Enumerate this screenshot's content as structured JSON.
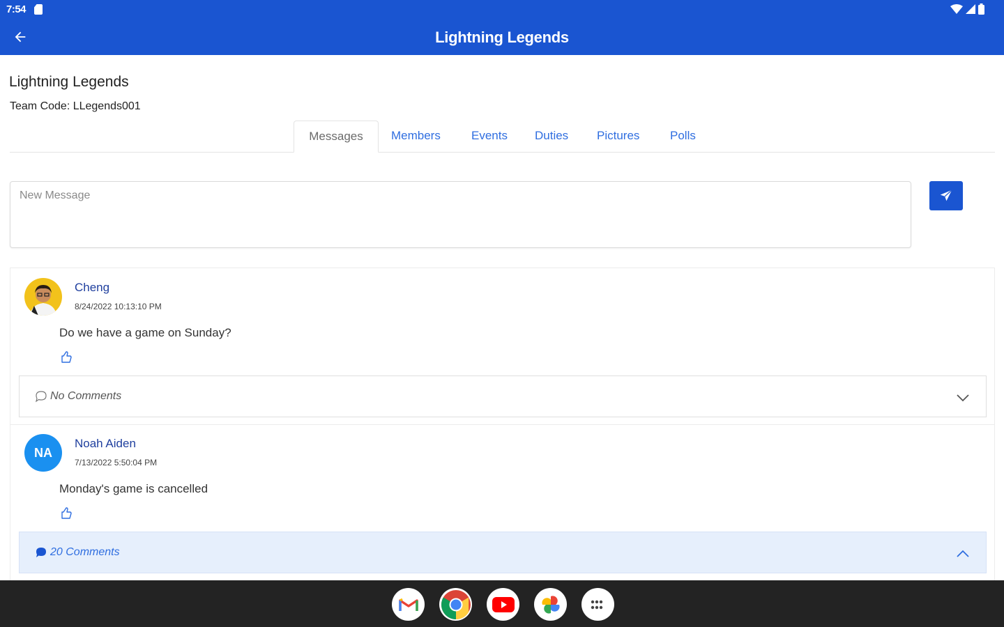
{
  "status_bar": {
    "time": "7:54"
  },
  "app_bar": {
    "title": "Lightning Legends"
  },
  "team": {
    "name": "Lightning Legends",
    "code_text": "Team Code: LLegends001"
  },
  "tabs": [
    {
      "label": "Messages",
      "active": true
    },
    {
      "label": "Members",
      "active": false
    },
    {
      "label": "Events",
      "active": false
    },
    {
      "label": "Duties",
      "active": false
    },
    {
      "label": "Pictures",
      "active": false
    },
    {
      "label": "Polls",
      "active": false
    }
  ],
  "composer": {
    "placeholder": "New Message",
    "value": ""
  },
  "posts": [
    {
      "author": "Cheng",
      "timestamp": "8/24/2022 10:13:10 PM",
      "text": "Do we have a game on Sunday?",
      "comments_label": "No Comments",
      "expanded": false
    },
    {
      "author": "Noah Aiden",
      "avatar_initials": "NA",
      "timestamp": "7/13/2022 5:50:04 PM",
      "text": "Monday's game is cancelled",
      "comments_label": "20 Comments",
      "expanded": true
    }
  ],
  "dock": [
    "gmail-icon",
    "chrome-icon",
    "youtube-icon",
    "photos-icon",
    "app-launcher-icon"
  ],
  "colors": {
    "primary": "#1a55d1",
    "tab_link": "#2f6ee0",
    "author": "#1f3f9e",
    "expanded_bar": "#e6effc"
  }
}
